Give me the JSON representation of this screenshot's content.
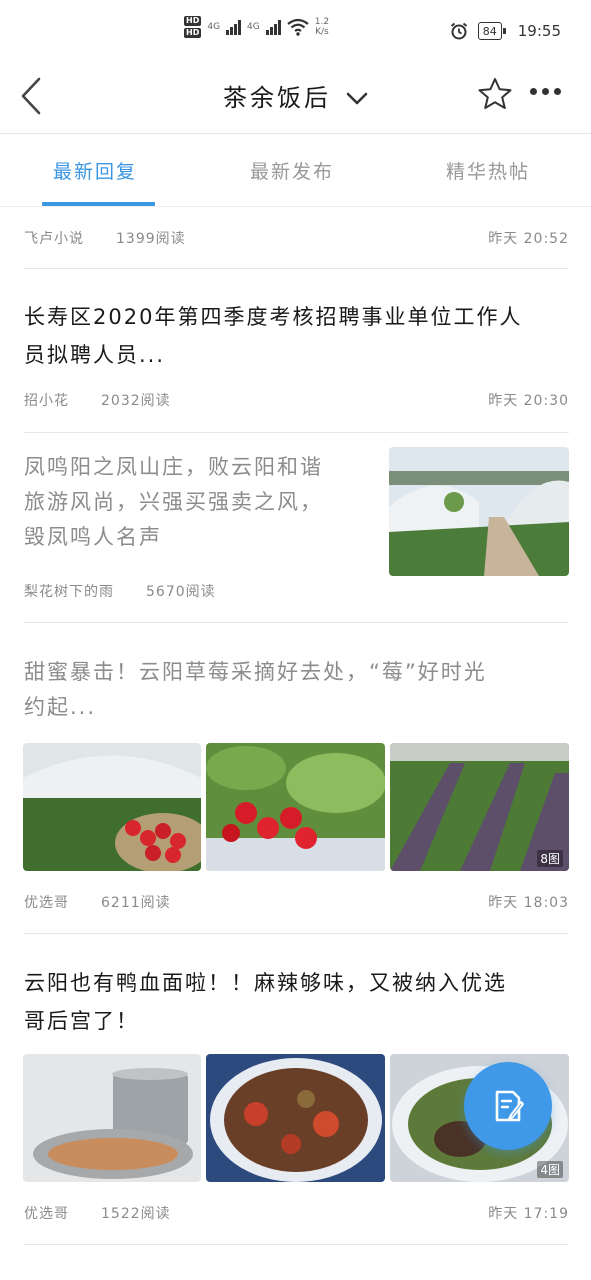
{
  "status_bar": {
    "hd_labels": [
      "HD",
      "HD"
    ],
    "network_1": "4G",
    "network_2": "4G",
    "speed_value": "1.2",
    "speed_unit": "K/s",
    "battery": "84",
    "time": "19:55"
  },
  "nav": {
    "title": "茶余饭后"
  },
  "tabs": [
    {
      "label": "最新回复",
      "active": true
    },
    {
      "label": "最新发布",
      "active": false
    },
    {
      "label": "精华热帖",
      "active": false
    }
  ],
  "posts": [
    {
      "author": "飞卢小说",
      "views": "1399阅读",
      "time": "昨天  20:52"
    },
    {
      "title_line1": "长寿区2020年第四季度考核招聘事业单位工作人",
      "title_line2": "员拟聘人员...",
      "author": "招小花",
      "views": "2032阅读",
      "time": "昨天  20:30"
    },
    {
      "title_line1": "凤鸣阳之凤山庄，败云阳和谐",
      "title_line2": "旅游风尚，兴强买强卖之风，",
      "title_line3": "毁凤鸣人名声",
      "author": "梨花树下的雨",
      "views": "5670阅读"
    },
    {
      "title_line1": "甜蜜暴击！云阳草莓采摘好去处，“莓”好时光",
      "title_line2": "约起...",
      "image_count": "8图",
      "author": "优选哥",
      "views": "6211阅读",
      "time": "昨天  18:03"
    },
    {
      "title_line1": "云阳也有鸭血面啦！！麻辣够味，又被纳入优选",
      "title_line2": "哥后宫了！",
      "image_count": "4图",
      "author": "优选哥",
      "views": "1522阅读",
      "time": "昨天  17:19"
    }
  ],
  "colors": {
    "accent": "#3b96e4",
    "fab": "#3f99e8"
  },
  "icons": [
    "back-arrow-icon",
    "chevron-down-icon",
    "star-icon",
    "more-icon",
    "edit-icon",
    "alarm-icon",
    "wifi-icon",
    "signal-icon"
  ]
}
